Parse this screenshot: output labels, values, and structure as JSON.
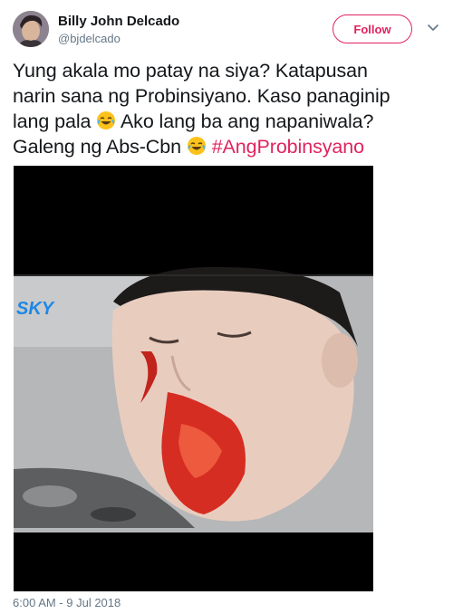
{
  "header": {
    "display_name": "Billy John Delcado",
    "handle": "@bjdelcado",
    "follow_label": "Follow"
  },
  "tweet": {
    "text_line1": "Yung akala mo patay na siya? Katapusan",
    "text_line2": "narin sana ng Probinsiyano. Kaso panaginip",
    "text_line3_a": "lang pala",
    "text_line3_b": "Ako lang ba ang napaniwala?",
    "text_line4_a": "Galeng ng Abs-Cbn",
    "hashtag": "#AngProbinsyano",
    "emoji": "face-with-tears-of-joy-icon"
  },
  "media": {
    "watermark": "SKY"
  },
  "footer": {
    "timestamp": "6:00 AM - 9 Jul 2018"
  },
  "colors": {
    "accent": "#e0245e",
    "text": "#14171a",
    "muted": "#657786"
  }
}
